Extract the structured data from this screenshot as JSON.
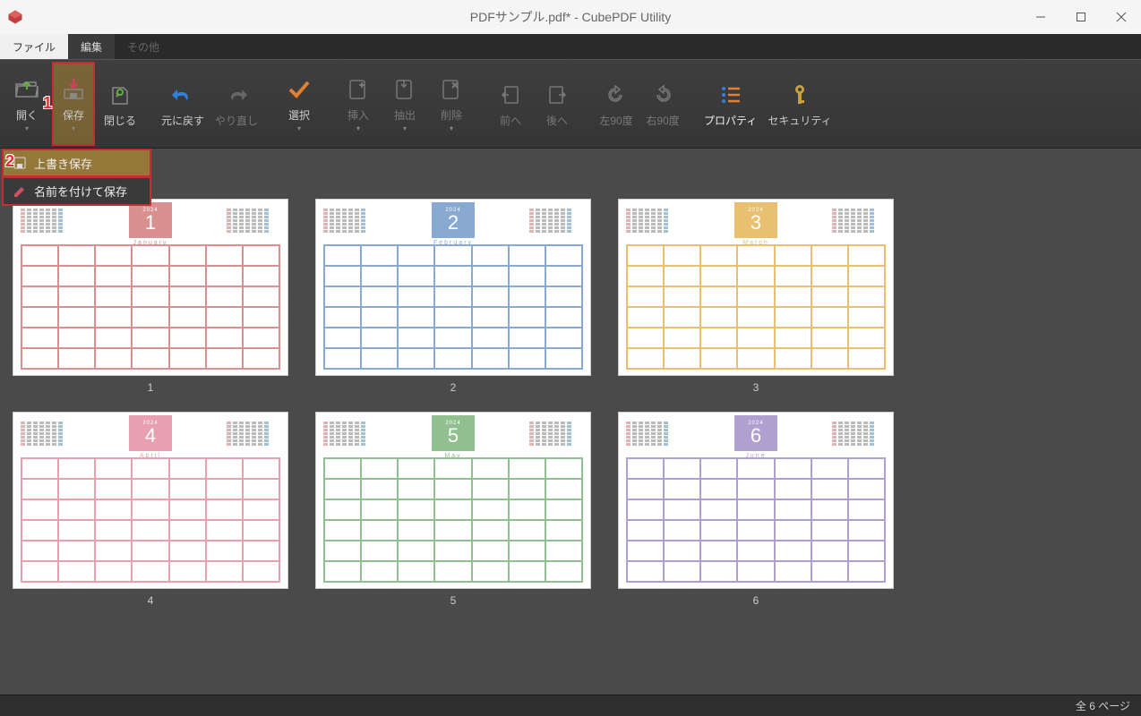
{
  "window": {
    "title": "PDFサンプル.pdf* - CubePDF Utility"
  },
  "menubar": {
    "file": "ファイル",
    "edit": "編集",
    "other": "その他"
  },
  "toolbar": {
    "open": "開く",
    "save": "保存",
    "close": "閉じる",
    "undo": "元に戻す",
    "redo": "やり直し",
    "select": "選択",
    "insert": "挿入",
    "extract": "抽出",
    "delete": "削除",
    "prev": "前へ",
    "next": "後へ",
    "rotate_left": "左90度",
    "rotate_right": "右90度",
    "property": "プロパティ",
    "security": "セキュリティ"
  },
  "dropdown": {
    "overwrite": "上書き保存",
    "saveas": "名前を付けて保存"
  },
  "annotations": {
    "one": "1",
    "two": "2"
  },
  "pages": [
    {
      "num": "1",
      "month": "1",
      "year": "2024",
      "name": "January",
      "color": "#d89090",
      "light": "#f5e0e0"
    },
    {
      "num": "2",
      "month": "2",
      "year": "2024",
      "name": "February",
      "color": "#88aad0",
      "light": "#e0e8f0"
    },
    {
      "num": "3",
      "month": "3",
      "year": "2024",
      "name": "March",
      "color": "#e8c070",
      "light": "#f5ecd8"
    },
    {
      "num": "4",
      "month": "4",
      "year": "2024",
      "name": "April",
      "color": "#e8a0b0",
      "light": "#f5e5e8"
    },
    {
      "num": "5",
      "month": "5",
      "year": "2024",
      "name": "May",
      "color": "#90c090",
      "light": "#e5f0e5"
    },
    {
      "num": "6",
      "month": "6",
      "year": "2024",
      "name": "June",
      "color": "#b0a0d0",
      "light": "#ece8f2"
    }
  ],
  "status": {
    "text": "全 6 ページ"
  }
}
